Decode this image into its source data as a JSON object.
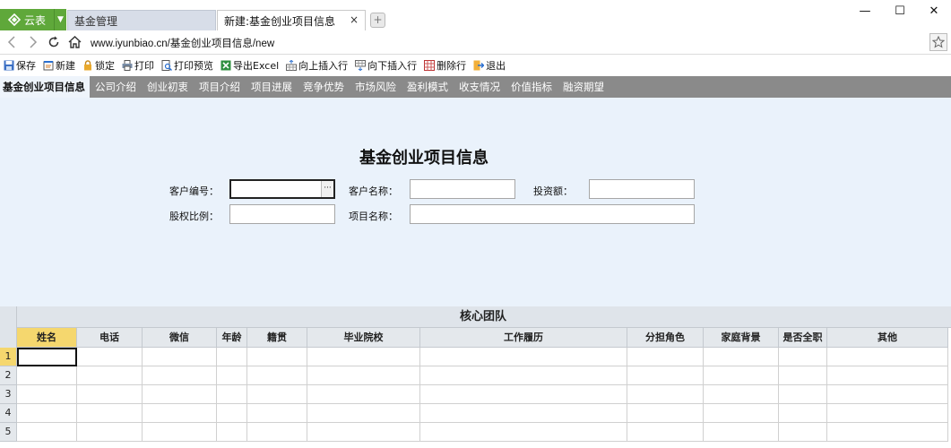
{
  "browser": {
    "app_button_label": "云表",
    "tabs": [
      {
        "label": "基金管理",
        "active": false
      },
      {
        "label": "新建:基金创业项目信息",
        "active": true
      }
    ],
    "close_glyph": "×",
    "new_tab_glyph": "+",
    "address": "www.iyunbiao.cn/基金创业项目信息/new",
    "window_controls": {
      "minimize": "—",
      "maximize": "☐",
      "close": "✕"
    }
  },
  "toolbar": {
    "items": [
      {
        "label": "保存",
        "icon": "save-icon"
      },
      {
        "label": "新建",
        "icon": "new-icon"
      },
      {
        "label": "锁定",
        "icon": "lock-icon"
      },
      {
        "label": "打印",
        "icon": "print-icon"
      },
      {
        "label": "打印预览",
        "icon": "print-preview-icon"
      },
      {
        "label": "导出Excel",
        "icon": "excel-icon"
      },
      {
        "label": "向上插入行",
        "icon": "insert-row-above-icon"
      },
      {
        "label": "向下插入行",
        "icon": "insert-row-below-icon"
      },
      {
        "label": "删除行",
        "icon": "delete-row-icon"
      },
      {
        "label": "退出",
        "icon": "exit-icon"
      }
    ]
  },
  "section_tabs": [
    "基金创业项目信息",
    "公司介绍",
    "创业初衷",
    "项目介绍",
    "项目进展",
    "竞争优势",
    "市场风险",
    "盈利模式",
    "收支情况",
    "价值指标",
    "融资期望"
  ],
  "form": {
    "title": "基金创业项目信息",
    "fields": {
      "customer_no": {
        "label": "客户编号：",
        "value": "",
        "picker_glyph": "···"
      },
      "customer_name": {
        "label": "客户名称：",
        "value": ""
      },
      "investment": {
        "label": "投资额：",
        "value": ""
      },
      "equity_ratio": {
        "label": "股权比例：",
        "value": ""
      },
      "project_name": {
        "label": "项目名称：",
        "value": ""
      }
    }
  },
  "team_grid": {
    "title": "核心团队",
    "columns": [
      "姓名",
      "电话",
      "微信",
      "年龄",
      "籍贯",
      "毕业院校",
      "工作履历",
      "分担角色",
      "家庭背景",
      "是否全职",
      "其他"
    ],
    "row_numbers": [
      "1",
      "2",
      "3",
      "4",
      "5"
    ],
    "selected_cell": {
      "row": 1,
      "column": "姓名"
    }
  },
  "colors": {
    "app_green": "#5fa83a",
    "section_bar": "#8a8a8a",
    "form_background": "#eaf2fb",
    "selected_header": "#f5d76e"
  }
}
